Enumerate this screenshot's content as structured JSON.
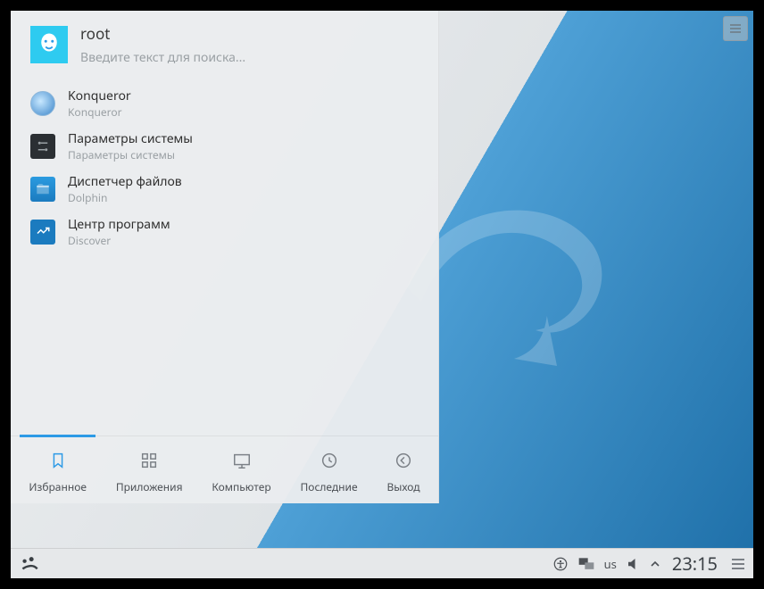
{
  "user": {
    "name": "root"
  },
  "search": {
    "placeholder": "Введите текст для поиска..."
  },
  "apps": [
    {
      "title": "Konqueror",
      "subtitle": "Konqueror",
      "icon": "globe"
    },
    {
      "title": "Параметры системы",
      "subtitle": "Параметры системы",
      "icon": "settings"
    },
    {
      "title": "Диспетчер файлов",
      "subtitle": "Dolphin",
      "icon": "files"
    },
    {
      "title": "Центр программ",
      "subtitle": "Discover",
      "icon": "discover"
    }
  ],
  "tabs": {
    "favorites": "Избранное",
    "applications": "Приложения",
    "computer": "Компьютер",
    "recent": "Последние",
    "leave": "Выход"
  },
  "tray": {
    "keyboard_layout": "us",
    "clock": "23:15"
  }
}
